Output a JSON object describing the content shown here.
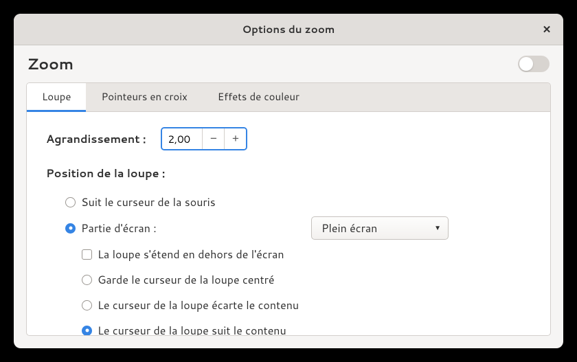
{
  "window": {
    "title": "Options du zoom"
  },
  "header": {
    "zoom_label": "Zoom"
  },
  "tabs": {
    "loupe": "Loupe",
    "pointeurs": "Pointeurs en croix",
    "effets": "Effets de couleur",
    "active": "loupe"
  },
  "magnification": {
    "label": "Agrandissement :",
    "value": "2,00",
    "minus": "−",
    "plus": "+"
  },
  "position": {
    "label": "Position de la loupe :",
    "opt_follow_mouse": "Suit le curseur de la souris",
    "opt_screen_part": "Partie d'écran :",
    "dropdown_value": "Plein écran",
    "sub_extends": "La loupe s'étend en dehors de l'écran",
    "sub_centered": "Garde le curseur de la loupe centré",
    "sub_pushes": "Le curseur de la loupe écarte le contenu",
    "sub_follows": "Le curseur de la loupe suit le contenu"
  }
}
